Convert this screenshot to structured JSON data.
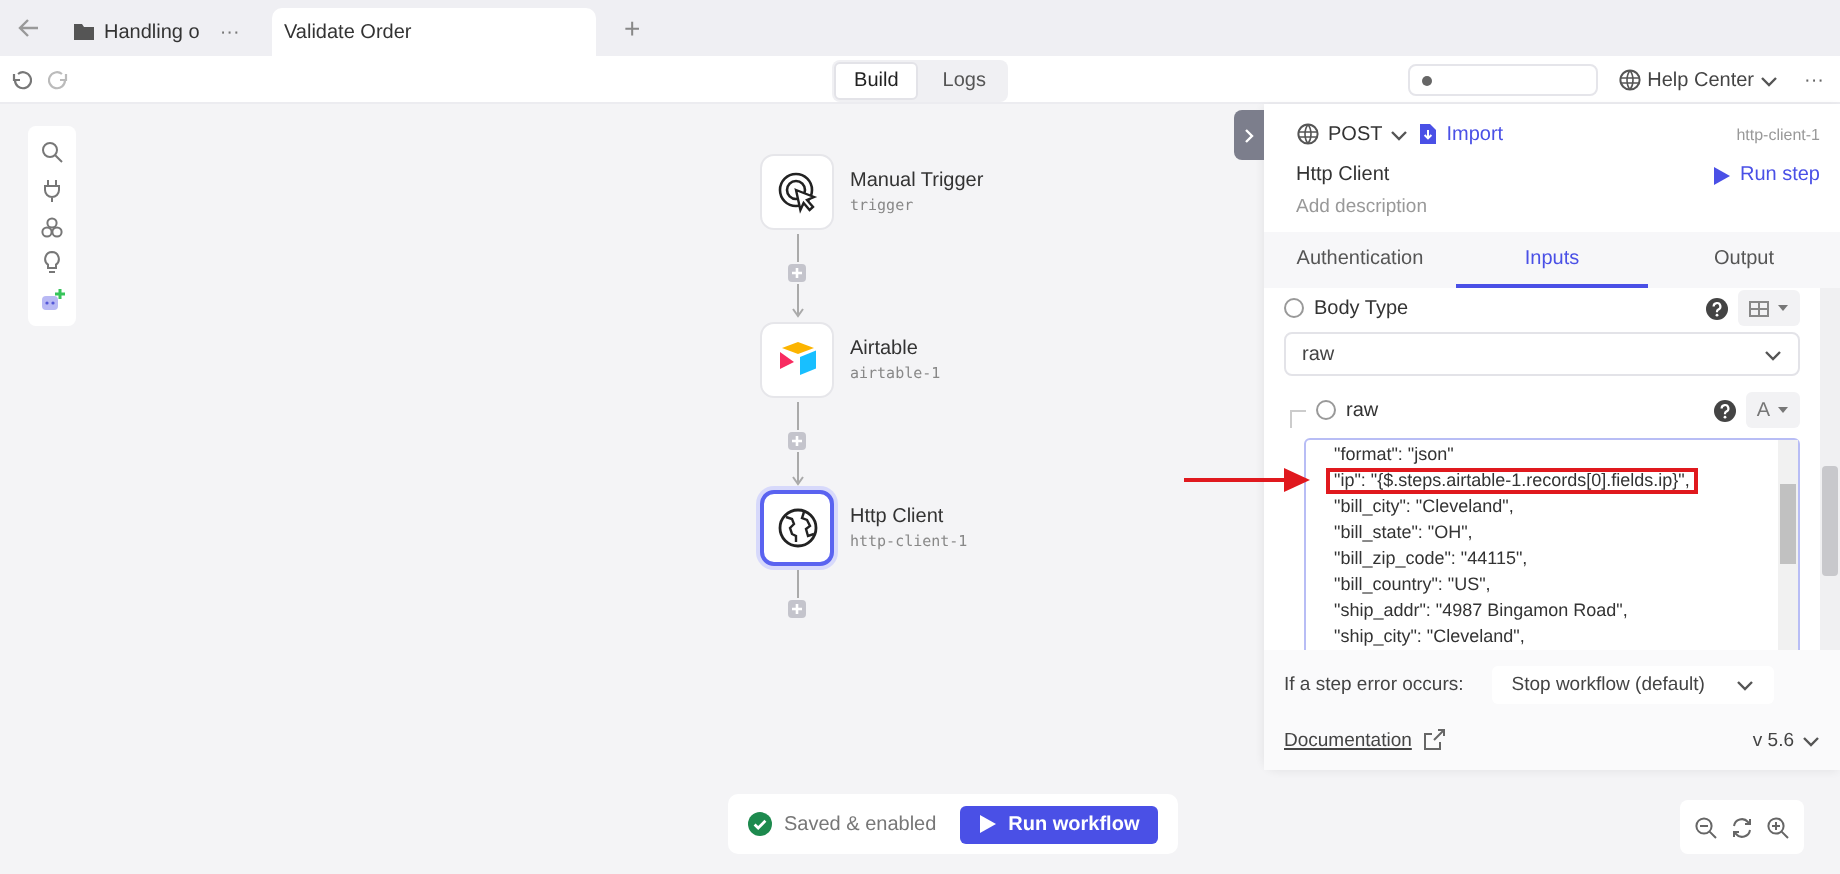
{
  "tabs": [
    {
      "label": "Handling o",
      "kind": "folder",
      "more": "···",
      "selected": false
    },
    {
      "label": "Validate Order",
      "kind": "page",
      "selected": true
    }
  ],
  "new_tab": "+",
  "toolbar": {
    "views": [
      {
        "label": "Build",
        "selected": true
      },
      {
        "label": "Logs",
        "selected": false
      }
    ],
    "help": "Help Center",
    "more": "···"
  },
  "canvas": {
    "nodes": [
      {
        "title": "Manual Trigger",
        "slug": "trigger",
        "kind": "trigger",
        "selected": false
      },
      {
        "title": "Airtable",
        "slug": "airtable-1",
        "kind": "airtable",
        "selected": false
      },
      {
        "title": "Http Client",
        "slug": "http-client-1",
        "kind": "http",
        "selected": true
      }
    ]
  },
  "panel": {
    "method": "POST",
    "import": "Import",
    "step_id": "http-client-1",
    "title": "Http Client",
    "run_step": "Run step",
    "description_placeholder": "Add description",
    "tabs": [
      {
        "label": "Authentication",
        "selected": false
      },
      {
        "label": "Inputs",
        "selected": true
      },
      {
        "label": "Output",
        "selected": false
      }
    ],
    "body_type": {
      "label": "Body Type",
      "checked": false
    },
    "body_type_value": "raw",
    "raw": {
      "label": "raw",
      "checked": false,
      "mode": "A"
    },
    "code_lines": [
      {
        "text": "\"format\": \"json\"",
        "highlighted": false
      },
      {
        "text": "\"ip\": \"{$.steps.airtable-1.records[0].fields.ip}\",",
        "highlighted": true
      },
      {
        "text": "\"bill_city\": \"Cleveland\",",
        "highlighted": false
      },
      {
        "text": "\"bill_state\": \"OH\",",
        "highlighted": false
      },
      {
        "text": "\"bill_zip_code\": \"44115\",",
        "highlighted": false
      },
      {
        "text": "\"bill_country\": \"US\",",
        "highlighted": false
      },
      {
        "text": "\"ship_addr\": \"4987 Bingamon Road\",",
        "highlighted": false
      },
      {
        "text": "\"ship_city\": \"Cleveland\",",
        "highlighted": false
      }
    ],
    "error_label": "If a step error occurs:",
    "error_value": "Stop workflow (default)",
    "documentation": "Documentation",
    "version": "v 5.6"
  },
  "footer": {
    "status": "Saved & enabled",
    "run": "Run workflow"
  }
}
